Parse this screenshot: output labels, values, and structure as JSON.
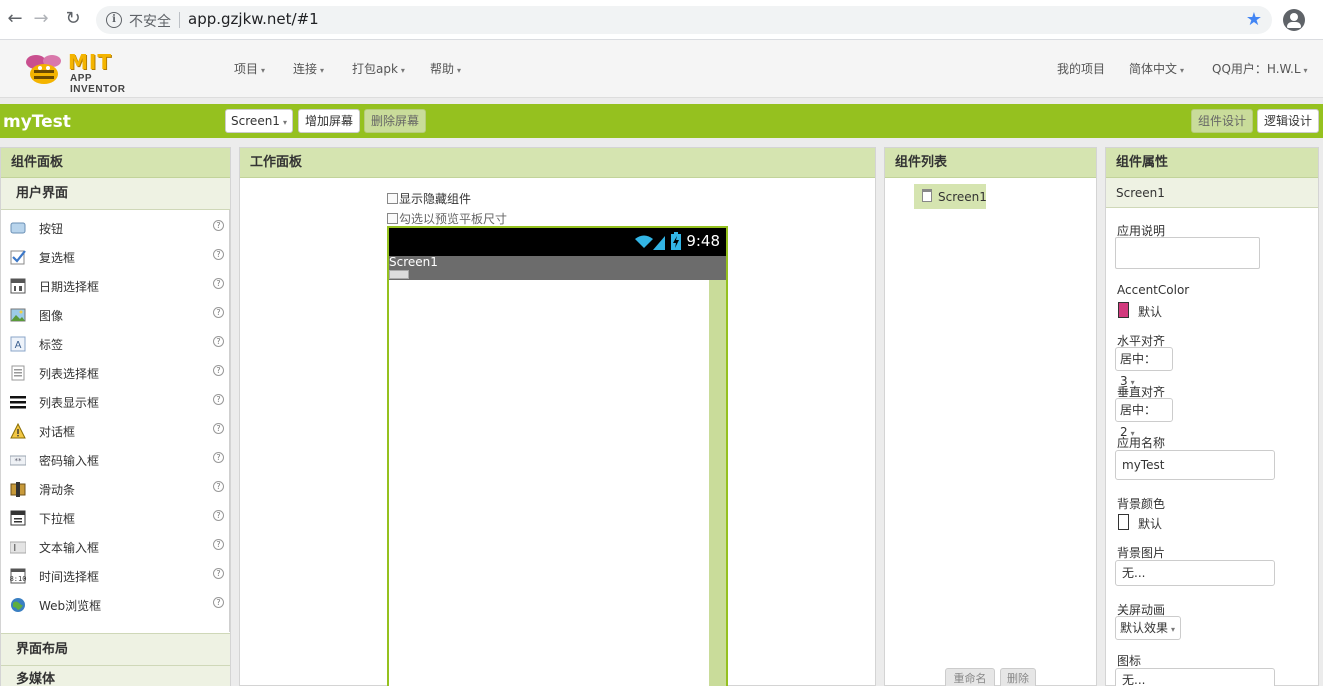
{
  "browser": {
    "back": "←",
    "forward": "→",
    "reload": "↻",
    "info": "i",
    "security": "不安全",
    "url": "app.gzjkw.net/#1",
    "star": "★"
  },
  "header": {
    "logo_mit": "MIT",
    "logo_ai": "APP INVENTOR",
    "menus": [
      "项目",
      "连接",
      "打包apk",
      "帮助"
    ],
    "my_projects": "我的项目",
    "language": "简体中文",
    "user": "QQ用户：H.W.L",
    "caret": "▾"
  },
  "toolbar": {
    "project_name": "myTest",
    "screen_select": "Screen1",
    "add_screen": "增加屏幕",
    "remove_screen": "删除屏幕",
    "designer": "组件设计",
    "blocks": "逻辑设计"
  },
  "palette": {
    "title": "组件面板",
    "section": "用户界面",
    "help": "?",
    "items": [
      {
        "label": "按钮",
        "icon": "button-icon"
      },
      {
        "label": "复选框",
        "icon": "checkbox-icon"
      },
      {
        "label": "日期选择框",
        "icon": "datepicker-icon"
      },
      {
        "label": "图像",
        "icon": "image-icon"
      },
      {
        "label": "标签",
        "icon": "label-icon"
      },
      {
        "label": "列表选择框",
        "icon": "listpicker-icon"
      },
      {
        "label": "列表显示框",
        "icon": "listview-icon"
      },
      {
        "label": "对话框",
        "icon": "notifier-icon"
      },
      {
        "label": "密码输入框",
        "icon": "password-icon"
      },
      {
        "label": "滑动条",
        "icon": "slider-icon"
      },
      {
        "label": "下拉框",
        "icon": "spinner-icon"
      },
      {
        "label": "文本输入框",
        "icon": "textbox-icon"
      },
      {
        "label": "时间选择框",
        "icon": "timepicker-icon"
      },
      {
        "label": "Web浏览框",
        "icon": "webviewer-icon"
      }
    ],
    "layout_section": "界面布局",
    "media_section": "多媒体"
  },
  "viewer": {
    "title": "工作面板",
    "show_hidden": "显示隐藏组件",
    "tablet_preview": "勾选以预览平板尺寸",
    "time": "9:48",
    "screen_title": "Screen1"
  },
  "components": {
    "title": "组件列表",
    "root": "Screen1",
    "rename": "重命名",
    "delete": "删除"
  },
  "properties": {
    "title": "组件属性",
    "component": "Screen1",
    "about_label": "应用说明",
    "accent_label": "AccentColor",
    "accent_value": "默认",
    "accent_color": "#d23a7e",
    "align_h_label": "水平对齐",
    "align_h_value": "居中：3",
    "align_v_label": "垂直对齐",
    "align_v_value": "居中：2",
    "app_name_label": "应用名称",
    "app_name_value": "myTest",
    "bg_color_label": "背景颜色",
    "bg_color_value": "默认",
    "bg_color": "#ffffff",
    "bg_image_label": "背景图片",
    "bg_image_value": "无...",
    "close_anim_label": "关屏动画",
    "close_anim_value": "默认效果",
    "icon_label": "图标",
    "icon_value": "无..."
  },
  "colors": {
    "accent_green": "#95c11f",
    "panel_head": "#d5e4b0"
  }
}
